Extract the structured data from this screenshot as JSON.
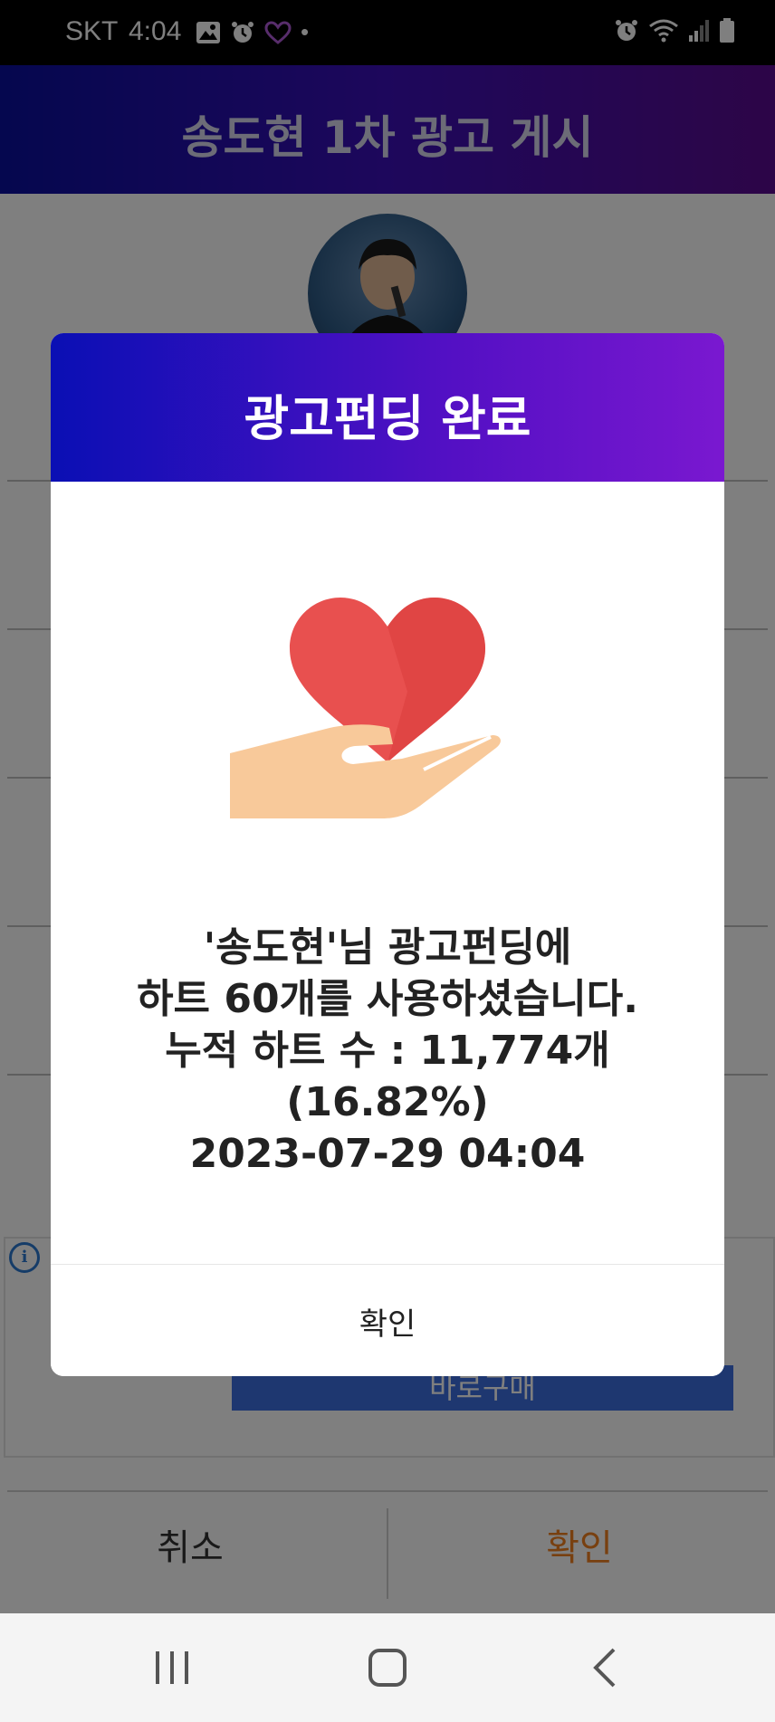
{
  "status_bar": {
    "carrier": "SKT",
    "time": "4:04",
    "dot": "•"
  },
  "app": {
    "title": "송도현 1차 광고 게시"
  },
  "background": {
    "buy_now_label": "바로구매",
    "cancel_label": "취소",
    "confirm_label": "확인"
  },
  "dialog": {
    "title": "광고펀딩 완료",
    "message_line1": "'송도현'님 광고펀딩에",
    "message_line2": "하트 60개를 사용하셨습니다.",
    "message_line3": "누적 하트 수 : 11,774개",
    "message_line4": "(16.82%)",
    "message_line5": "2023-07-29 04:04",
    "ok_label": "확인"
  },
  "colors": {
    "header_gradient_start": "#0a0fb4",
    "header_gradient_end": "#7a18d0",
    "confirm_accent": "#f08020",
    "heart": "#e8504f",
    "hand": "#f8c99a"
  }
}
